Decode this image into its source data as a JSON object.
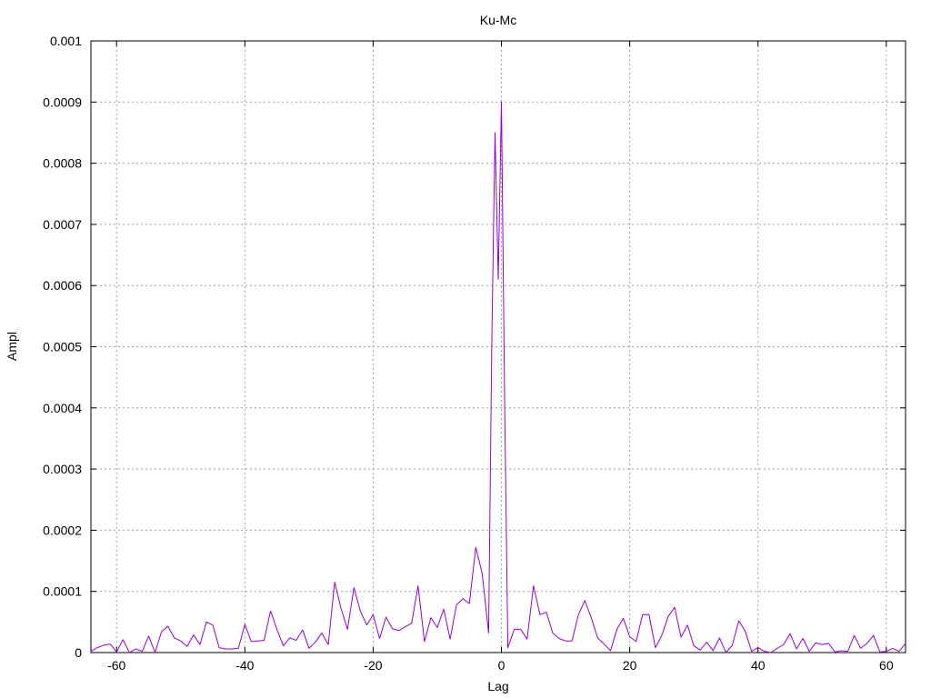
{
  "chart_data": {
    "type": "line",
    "title": "Ku-Mc",
    "xlabel": "Lag",
    "ylabel": "Ampl",
    "xlim": [
      -64,
      63
    ],
    "ylim": [
      0,
      0.001
    ],
    "grid": true,
    "x_ticks": [
      "-60",
      "-40",
      "-20",
      "0",
      "20",
      "40",
      "60"
    ],
    "y_ticks": [
      "0",
      "0.0001",
      "0.0002",
      "0.0003",
      "0.0004",
      "0.0005",
      "0.0006",
      "0.0007",
      "0.0008",
      "0.0009",
      "0.001"
    ],
    "line_color": "#9400d3",
    "series": [
      {
        "x": [
          -64,
          -63,
          -62,
          -61,
          -60,
          -59,
          -58,
          -57,
          -56,
          -55,
          -54,
          -53,
          -52,
          -51,
          -50,
          -49,
          -48,
          -47,
          -46,
          -45,
          -44,
          -43,
          -42,
          -41,
          -40,
          -39,
          -38,
          -37,
          -36,
          -35,
          -34,
          -33,
          -32,
          -31,
          -30,
          -29,
          -28,
          -27,
          -26,
          -25,
          -24,
          -23,
          -22,
          -21,
          -20,
          -19,
          -18,
          -17,
          -16,
          -15,
          -14,
          -13,
          -12,
          -11,
          -10,
          -9,
          -8,
          -7,
          -6,
          -5,
          -4,
          -3,
          -2,
          -1.5,
          -1,
          -0.5,
          0,
          0.5,
          1,
          2,
          3,
          4,
          5,
          6,
          7,
          8,
          9,
          10,
          11,
          12,
          13,
          14,
          15,
          16,
          17,
          18,
          19,
          20,
          21,
          22,
          23,
          24,
          25,
          26,
          27,
          28,
          29,
          30,
          31,
          32,
          33,
          34,
          35,
          36,
          37,
          38,
          39,
          40,
          41,
          42,
          43,
          44,
          45,
          46,
          47,
          48,
          49,
          50,
          51,
          52,
          53,
          54,
          55,
          56,
          57,
          58,
          59,
          60,
          61,
          62,
          63
        ],
        "values": [
          2e-06,
          8e-06,
          1.2e-05,
          1.4e-05,
          1e-06,
          2.1e-05,
          0.0,
          6e-06,
          2e-06,
          2.7e-05,
          0.0,
          3.4e-05,
          4.3e-05,
          2.4e-05,
          1.9e-05,
          1e-05,
          2.9e-05,
          1.3e-05,
          5e-05,
          4.5e-05,
          8e-06,
          6e-06,
          6e-06,
          7e-06,
          4.6e-05,
          1.8e-05,
          1.9e-05,
          2e-05,
          6.8e-05,
          3.8e-05,
          1.1e-05,
          2.4e-05,
          2e-05,
          3.7e-05,
          7e-06,
          1.7e-05,
          3.2e-05,
          1.3e-05,
          0.000115,
          7.2e-05,
          3.8e-05,
          0.000106,
          6.8e-05,
          4.5e-05,
          6.2e-05,
          2.3e-05,
          5.8e-05,
          3.9e-05,
          3.6e-05,
          4.2e-05,
          4.8e-05,
          0.000109,
          1.8e-05,
          5.7e-05,
          4.1e-05,
          7.1e-05,
          2.2e-05,
          7.8e-05,
          8.8e-05,
          8e-05,
          0.000172,
          0.000129,
          3.2e-05,
          0.00051,
          0.00085,
          0.00061,
          0.0009,
          0.00041,
          8e-06,
          3.8e-05,
          3.8e-05,
          2.2e-05,
          0.000109,
          6.2e-05,
          6.6e-05,
          3.2e-05,
          2.3e-05,
          1.9e-05,
          1.9e-05,
          6.2e-05,
          8.5e-05,
          5.7e-05,
          2.4e-05,
          1.4e-05,
          3e-06,
          3.8e-05,
          5.6e-05,
          2.6e-05,
          1.8e-05,
          6.2e-05,
          6.2e-05,
          8e-06,
          2.8e-05,
          5.9e-05,
          7.4e-05,
          2.5e-05,
          4.5e-05,
          1.1e-05,
          4e-06,
          1.7e-05,
          3e-06,
          2.4e-05,
          0.0,
          1.2e-05,
          5.2e-05,
          3.5e-05,
          2e-06,
          8e-06,
          2e-06,
          0.0,
          7e-06,
          1.3e-05,
          3.1e-05,
          6e-06,
          2.3e-05,
          2e-06,
          1.6e-05,
          1.3e-05,
          1.5e-05,
          1e-06,
          3e-06,
          2e-06,
          2.8e-05,
          7e-06,
          1.5e-05,
          2.8e-05,
          1e-06,
          2e-06,
          7e-06,
          2e-06,
          1.5e-05
        ]
      }
    ]
  }
}
